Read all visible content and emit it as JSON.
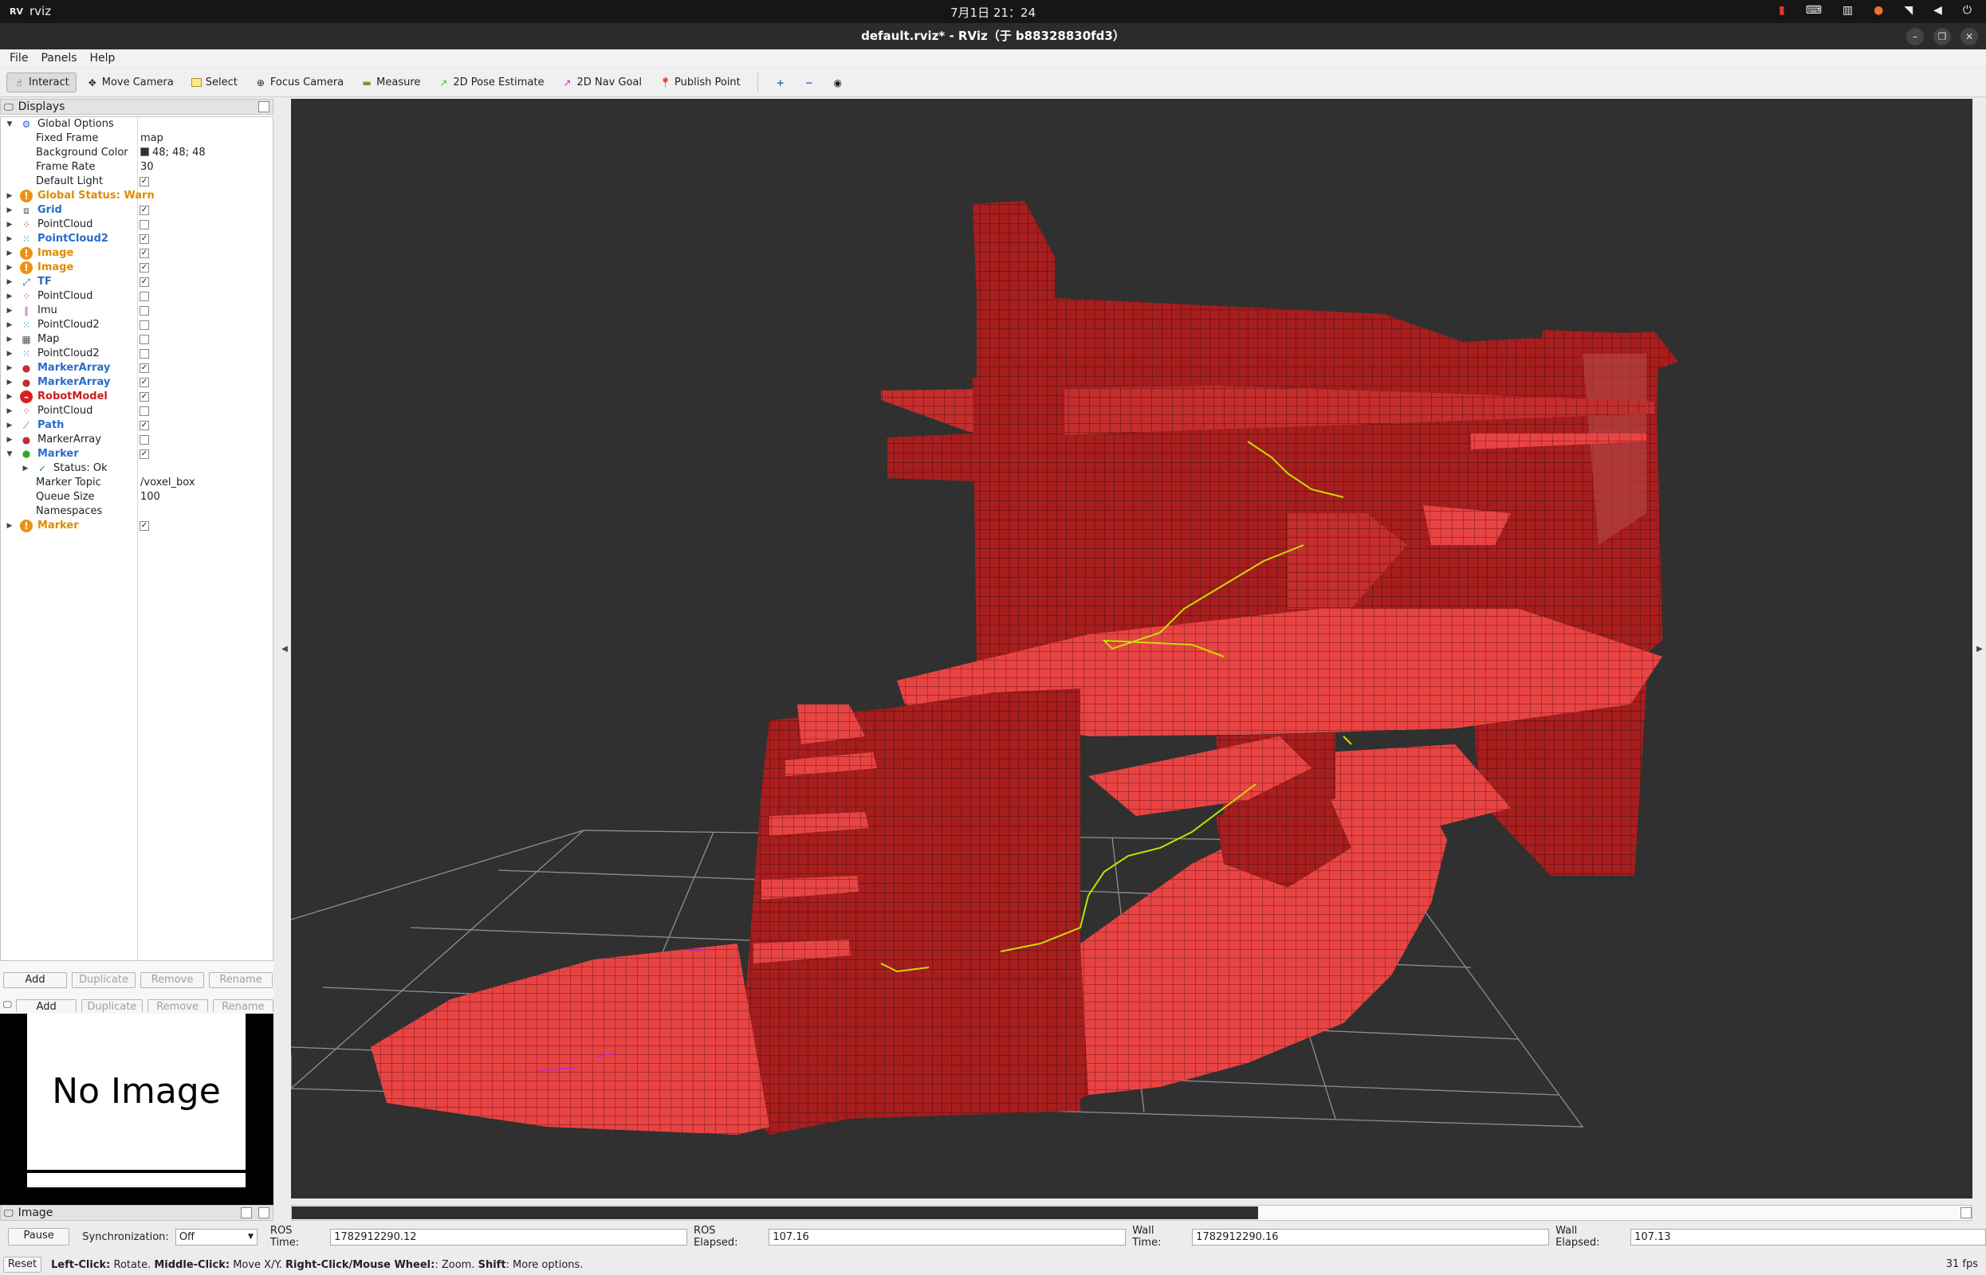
{
  "system": {
    "app_name": "rviz",
    "clock": "7月1日 21：24"
  },
  "window": {
    "title": "default.rviz* - RViz（于 b88328830fd3）"
  },
  "menu": [
    "File",
    "Panels",
    "Help"
  ],
  "toolbar": {
    "interact": "Interact",
    "move_camera": "Move Camera",
    "select": "Select",
    "focus_camera": "Focus Camera",
    "measure": "Measure",
    "pose_estimate": "2D Pose Estimate",
    "nav_goal": "2D Nav Goal",
    "publish_point": "Publish Point"
  },
  "displays": {
    "title": "Displays",
    "global_options": {
      "label": "Global Options",
      "fixed_frame_label": "Fixed Frame",
      "fixed_frame": "map",
      "bg_color_label": "Background Color",
      "bg_color": "48; 48; 48",
      "frame_rate_label": "Frame Rate",
      "frame_rate": "30",
      "default_light_label": "Default Light"
    },
    "global_status": "Global Status: Warn",
    "items": [
      {
        "label": "Grid",
        "checked": true,
        "style": "blue",
        "icon": "grid-icon"
      },
      {
        "label": "PointCloud",
        "checked": false,
        "style": "",
        "icon": "pointcloud-icon"
      },
      {
        "label": "PointCloud2",
        "checked": true,
        "style": "blue",
        "icon": "pointcloud2-icon"
      },
      {
        "label": "Image",
        "checked": true,
        "style": "orange",
        "icon": "warning-icon"
      },
      {
        "label": "Image",
        "checked": true,
        "style": "orange",
        "icon": "warning-icon"
      },
      {
        "label": "TF",
        "checked": true,
        "style": "blue",
        "icon": "tf-icon"
      },
      {
        "label": "PointCloud",
        "checked": false,
        "style": "",
        "icon": "pointcloud-icon"
      },
      {
        "label": "Imu",
        "checked": false,
        "style": "",
        "icon": "imu-icon"
      },
      {
        "label": "PointCloud2",
        "checked": false,
        "style": "",
        "icon": "pointcloud2-icon"
      },
      {
        "label": "Map",
        "checked": false,
        "style": "",
        "icon": "map-icon"
      },
      {
        "label": "PointCloud2",
        "checked": false,
        "style": "",
        "icon": "pointcloud2-icon"
      },
      {
        "label": "MarkerArray",
        "checked": true,
        "style": "blue",
        "icon": "marker-array-icon"
      },
      {
        "label": "MarkerArray",
        "checked": true,
        "style": "blue",
        "icon": "marker-array-icon"
      },
      {
        "label": "RobotModel",
        "checked": true,
        "style": "red",
        "icon": "error-icon"
      },
      {
        "label": "PointCloud",
        "checked": false,
        "style": "",
        "icon": "pointcloud-icon"
      },
      {
        "label": "Path",
        "checked": true,
        "style": "blue",
        "icon": "path-icon"
      },
      {
        "label": "MarkerArray",
        "checked": false,
        "style": "",
        "icon": "marker-array-icon"
      }
    ],
    "marker": {
      "label": "Marker",
      "status": "Status: Ok",
      "topic_label": "Marker Topic",
      "topic": "/voxel_box",
      "queue_label": "Queue Size",
      "queue": "100",
      "namespaces_label": "Namespaces"
    },
    "marker2": {
      "label": "Marker"
    }
  },
  "buttons": {
    "add": "Add",
    "duplicate": "Duplicate",
    "remove": "Remove",
    "rename": "Rename"
  },
  "image_panel": {
    "title": "Image",
    "no_image": "No Image"
  },
  "time": {
    "pause": "Pause",
    "sync_label": "Synchronization:",
    "sync_value": "Off",
    "ros_time_label": "ROS Time:",
    "ros_time": "1782912290.12",
    "ros_elapsed_label": "ROS Elapsed:",
    "ros_elapsed": "107.16",
    "wall_time_label": "Wall Time:",
    "wall_time": "1782912290.16",
    "wall_elapsed_label": "Wall Elapsed:",
    "wall_elapsed": "107.13"
  },
  "status": {
    "reset": "Reset",
    "left": "Left-Click:",
    "left_text": "Rotate.",
    "middle": "Middle-Click:",
    "middle_text": "Move X/Y.",
    "right": "Right-Click/Mouse Wheel:",
    "right_text": ": Zoom.",
    "shift": "Shift",
    "shift_text": ": More options.",
    "fps": "31 fps"
  },
  "colors": {
    "background": "#303030",
    "voxel_light": "#e84444",
    "voxel_dark": "#a61e1e",
    "path": "#c8e000",
    "grid": "#a0a0a0"
  }
}
